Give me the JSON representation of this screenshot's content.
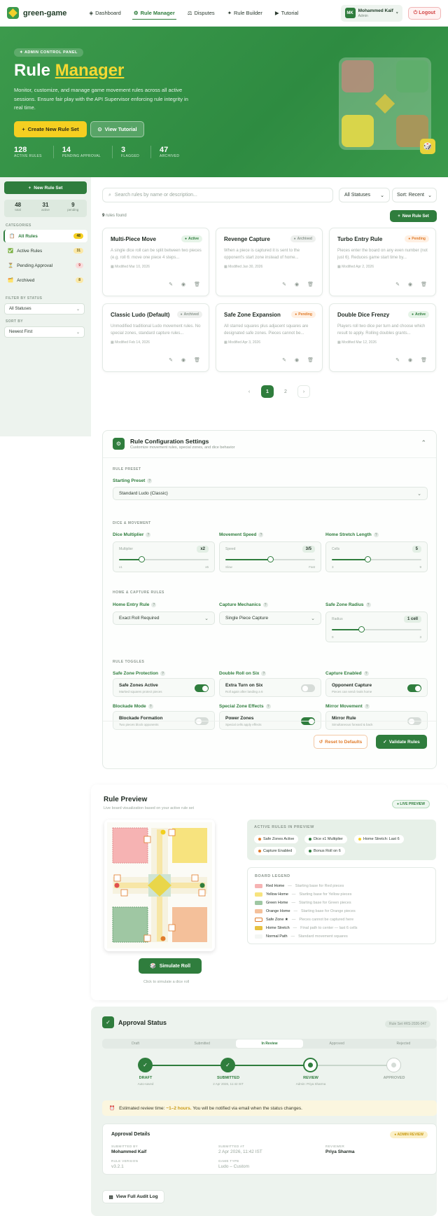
{
  "app": {
    "brand": "green-game"
  },
  "nav": {
    "items": [
      {
        "icon": "grid-icon",
        "label": "Dashboard"
      },
      {
        "icon": "gear-icon",
        "label": "Rule Manager"
      },
      {
        "icon": "scale-icon",
        "label": "Disputes"
      },
      {
        "icon": "sparkle-icon",
        "label": "Rule Builder"
      },
      {
        "icon": "play-icon",
        "label": "Tutorial"
      }
    ],
    "active": "Rule Manager"
  },
  "user": {
    "initials": "MK",
    "name": "Mohammed Kaif",
    "role": "Admin",
    "logout": "Logout"
  },
  "hero": {
    "badge": "ADMIN CONTROL PANEL",
    "title_a": "Rule",
    "title_b": "Manager",
    "desc": "Monitor, customize, and manage game movement rules across all active sessions. Ensure fair play with the API Supervisor enforcing rule integrity in real time.",
    "btn_create": "Create New Rule Set",
    "btn_tutorial": "View Tutorial",
    "stats": [
      {
        "n": "128",
        "l": "ACTIVE RULES"
      },
      {
        "n": "14",
        "l": "PENDING APPROVAL"
      },
      {
        "n": "3",
        "l": "FLAGGED"
      },
      {
        "n": "47",
        "l": "ARCHIVED"
      }
    ]
  },
  "sidebar": {
    "new_btn": "New Rule Set",
    "mini": [
      {
        "n": "48",
        "l": "total"
      },
      {
        "n": "31",
        "l": "active"
      },
      {
        "n": "9",
        "l": "pending"
      }
    ],
    "categories_h": "CATEGORIES",
    "items": [
      {
        "label": "All Rules",
        "count": "48",
        "icon": "📋"
      },
      {
        "label": "Active Rules",
        "count": "31",
        "icon": "✅"
      },
      {
        "label": "Pending Approval",
        "count": "9",
        "icon": "⏳"
      },
      {
        "label": "Archived",
        "count": "8",
        "icon": "🗂️"
      }
    ],
    "filter_h": "FILTER BY STATUS",
    "filter_val": "All Statuses",
    "sort_h": "SORT BY",
    "sort_val": "Newest First"
  },
  "toolbar": {
    "search_ph": "Search rules by name or description...",
    "status": "All Statuses",
    "sort": "Sort: Recent",
    "found_n": "9",
    "found_t": "rules found",
    "new_btn": "New Rule Set"
  },
  "cards": [
    {
      "title": "Multi-Piece Move",
      "status": "Active",
      "kind": "active",
      "desc": "A single dice roll can be split between two pieces (e.g. roll 6: move one piece 4 steps...",
      "date": "Modified Mar 10, 2026"
    },
    {
      "title": "Revenge Capture",
      "status": "Archived",
      "kind": "archived",
      "desc": "When a piece is captured it is sent to the opponent's start zone instead of home...",
      "date": "Modified Jan 30, 2026"
    },
    {
      "title": "Turbo Entry Rule",
      "status": "Pending",
      "kind": "pending",
      "desc": "Pieces enter the board on any even number (not just 6). Reduces game start time by...",
      "date": "Modified Apr 2, 2026"
    },
    {
      "title": "Classic Ludo (Default)",
      "status": "Archived",
      "kind": "archived",
      "desc": "Unmodified traditional Ludo movement rules. No special zones, standard capture rules...",
      "date": "Modified Feb 14, 2026"
    },
    {
      "title": "Safe Zone Expansion",
      "status": "Pending",
      "kind": "pending",
      "desc": "All starred squares plus adjacent squares are designated safe zones. Pieces cannot be...",
      "date": "Modified Apr 3, 2026"
    },
    {
      "title": "Double Dice Frenzy",
      "status": "Active",
      "kind": "active",
      "desc": "Players roll two dice per turn and choose which result to apply. Rolling doubles grants...",
      "date": "Modified Mar 12, 2026"
    }
  ],
  "pager": {
    "prev": "‹",
    "pages": [
      "1",
      "2"
    ],
    "next": "›"
  },
  "config": {
    "title": "Rule Configuration Settings",
    "subtitle": "Customize movement rules, special zones, and dice behavior",
    "g_preset": "RULE PRESET",
    "preset_l": "Starting Preset",
    "preset_v": "Standard Ludo (Classic)",
    "g_dice": "DICE & MOVEMENT",
    "sliders": [
      {
        "label": "Dice Multiplier",
        "name": "Multiplier",
        "val": "x2",
        "min": "x1",
        "max": "x5",
        "frac": 0.25
      },
      {
        "label": "Movement Speed",
        "name": "Speed",
        "val": "3/5",
        "min": "Slow",
        "max": "Fast",
        "frac": 0.5
      },
      {
        "label": "Home Stretch Length",
        "name": "Cells",
        "val": "5",
        "min": "3",
        "max": "9",
        "frac": 0.4
      }
    ],
    "g_home": "HOME & CAPTURE RULES",
    "home_entry_l": "Home Entry Rule",
    "home_entry_v": "Exact Roll Required",
    "capture_l": "Capture Mechanics",
    "capture_v": "Single Piece Capture",
    "radius_l": "Safe Zone Radius",
    "radius": {
      "name": "Radius",
      "val": "1 cell",
      "min": "0",
      "max": "3",
      "frac": 0.33
    },
    "g_toggles": "RULE TOGGLES",
    "toggles": [
      {
        "label": "Safe Zone Protection",
        "name": "Safe Zones Active",
        "desc": "Marked squares protect pieces",
        "on": true
      },
      {
        "label": "Double Roll on Six",
        "name": "Extra Turn on Six",
        "desc": "Roll again after landing a 6",
        "on": false
      },
      {
        "label": "Capture Enabled",
        "name": "Opponent Capture",
        "desc": "Pieces can send rivals home",
        "on": true
      },
      {
        "label": "Blockade Mode",
        "name": "Blockade Formation",
        "desc": "Two pieces block opponents",
        "on": false
      },
      {
        "label": "Special Zone Effects",
        "name": "Power Zones",
        "desc": "Special cells apply effects",
        "on": true
      },
      {
        "label": "Mirror Movement",
        "name": "Mirror Rule",
        "desc": "Simultaneous forward & back",
        "on": false
      }
    ],
    "reset": "Reset to Defaults",
    "validate": "Validate Rules"
  },
  "preview": {
    "title": "Rule Preview",
    "subtitle": "Live board visualization based on your active rule set",
    "live": "LIVE PREVIEW",
    "active_h": "ACTIVE RULES IN PREVIEW",
    "pills": [
      {
        "label": "Safe Zones Active",
        "color": "#e07b2a"
      },
      {
        "label": "Dice x1 Multiplier",
        "color": "#2f7d3d"
      },
      {
        "label": "Home Stretch: Last 6",
        "color": "#f5cf21"
      },
      {
        "label": "Capture Enabled",
        "color": "#e07b2a"
      },
      {
        "label": "Bonus Roll on 6",
        "color": "#2f7d3d"
      }
    ],
    "legend_h": "BOARD LEGEND",
    "legend": [
      {
        "name": "Red Home",
        "desc": "Starting base for Red pieces",
        "color": "#f6b3b3"
      },
      {
        "name": "Yellow Home",
        "desc": "Starting base for Yellow pieces",
        "color": "#f7e37e"
      },
      {
        "name": "Green Home",
        "desc": "Starting base for Green pieces",
        "color": "#9fc7a3"
      },
      {
        "name": "Orange Home",
        "desc": "Starting base for Orange pieces",
        "color": "#f4c09a"
      },
      {
        "name": "Safe Zone ★",
        "desc": "Pieces cannot be captured here",
        "color": "#ffffff"
      },
      {
        "name": "Home Stretch",
        "desc": "Final path to center — last 6 cells",
        "color": "#e8c140"
      },
      {
        "name": "Normal Path",
        "desc": "Standard movement squares",
        "color": "#f4f6f4"
      }
    ],
    "simulate": "Simulate Roll",
    "hint": "Click to simulate a dice roll"
  },
  "approval": {
    "title": "Approval Status",
    "ruleset": "Rule Set #RS-2026-047",
    "tabs": [
      "Draft",
      "Submitted",
      "In Review",
      "Approved",
      "Rejected"
    ],
    "active_tab": "In Review",
    "steps": [
      {
        "label": "DRAFT",
        "sub": "Auto-saved",
        "state": "done"
      },
      {
        "label": "SUBMITTED",
        "sub": "2 Apr 2026, 11:42 IST",
        "state": "done"
      },
      {
        "label": "REVIEW",
        "sub": "Admin: Priya Sharma",
        "state": "cur"
      },
      {
        "label": "APPROVED",
        "sub": "",
        "state": "todo"
      }
    ],
    "est_a": "Estimated review time:",
    "est_b": "~1–2 hours.",
    "est_c": "You will be notified via email when the status changes.",
    "details_h": "Approval Details",
    "details_badge": "ADMIN REVIEW",
    "submitted_by_l": "SUBMITTED BY",
    "submitted_by_v": "Mohammed Kaif",
    "submitted_at_l": "SUBMITTED AT",
    "submitted_at_v": "2 Apr 2026, 11:42 IST",
    "reviewer_l": "REVIEWER",
    "reviewer_v": "Priya Sharma",
    "version_l": "RULE VERSION",
    "version_v": "v3.2.1",
    "gametype_l": "GAME TYPE",
    "gametype_v": "Ludo – Custom",
    "audit": "View Full Audit Log"
  }
}
